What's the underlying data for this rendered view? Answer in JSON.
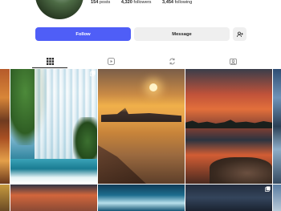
{
  "profile": {
    "posts_count": "154",
    "posts_label": "posts",
    "followers_count": "4,320",
    "followers_label": "followers",
    "following_count": "3,454",
    "following_label": "following"
  },
  "actions": {
    "follow_label": "Follow",
    "message_label": "Message",
    "add_user_icon": "person-add-icon"
  },
  "tabs": [
    {
      "name": "posts",
      "icon": "grid-icon",
      "active": true
    },
    {
      "name": "reels",
      "icon": "reels-icon",
      "active": false
    },
    {
      "name": "reposts",
      "icon": "repost-icon",
      "active": false
    },
    {
      "name": "tagged",
      "icon": "tagged-icon",
      "active": false
    }
  ],
  "colors": {
    "accent": "#4f5ef7",
    "secondary_button": "#efefef",
    "text": "#262626"
  },
  "grid": {
    "tiles": [
      {
        "subject": "autumn foliage (partial)"
      },
      {
        "subject": "waterfall",
        "badge": "multiple-posts-icon"
      },
      {
        "subject": "sunset over harbor town"
      },
      {
        "subject": "sunset lake with trees"
      },
      {
        "subject": "blue scene (partial)"
      },
      {
        "subject": "golden scene (partial)"
      },
      {
        "subject": "orange sky"
      },
      {
        "subject": "ocean wave"
      },
      {
        "subject": "night sky",
        "badge": "multiple-posts-icon"
      },
      {
        "subject": "blue scene (partial)"
      }
    ]
  }
}
